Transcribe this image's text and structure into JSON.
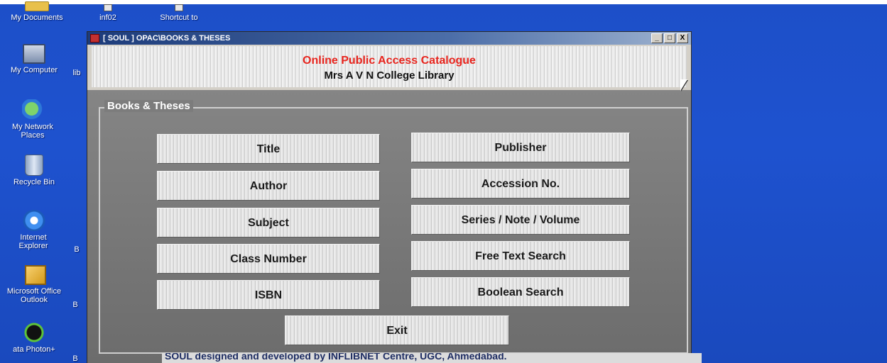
{
  "desktop": {
    "icons": [
      {
        "label": "My Documents",
        "icon": "folder-icon"
      },
      {
        "label": "inf02",
        "icon": "shortcut-icon"
      },
      {
        "label": "Shortcut to",
        "icon": "shortcut-icon"
      },
      {
        "label": "My Computer",
        "icon": "computer-icon"
      },
      {
        "label": "lib",
        "icon": "folder-icon"
      },
      {
        "label": "My Network Places",
        "icon": "network-icon"
      },
      {
        "label": "Recycle Bin",
        "icon": "recycle-bin-icon"
      },
      {
        "label": "Internet Explorer",
        "icon": "internet-explorer-icon"
      },
      {
        "label": "B",
        "icon": ""
      },
      {
        "label": "Microsoft Office Outlook",
        "icon": "outlook-icon"
      },
      {
        "label": "B",
        "icon": ""
      },
      {
        "label": "ata Photon+",
        "icon": "photon-icon"
      },
      {
        "label": "B",
        "icon": ""
      }
    ]
  },
  "window": {
    "title": "[ SOUL ] OPAC\\BOOKS & THESES",
    "controls": [
      "_",
      "□",
      "X"
    ]
  },
  "header": {
    "title": "Online Public Access Catalogue",
    "subtitle": "Mrs A V N College Library"
  },
  "panel": {
    "group_label": "Books & Theses",
    "buttons": {
      "title": "Title",
      "author": "Author",
      "subject": "Subject",
      "class_number": "Class Number",
      "isbn": "ISBN",
      "publisher": "Publisher",
      "accession": "Accession No.",
      "series": "Series / Note / Volume",
      "free_text": "Free Text Search",
      "boolean": "Boolean Search",
      "exit": "Exit"
    }
  },
  "footer": {
    "text": "SOUL designed and developed by INFLIBNET Centre, UGC, Ahmedabad."
  },
  "colors": {
    "desktop": "#1e52cf",
    "header_title": "#e8251e",
    "panel": "#7a7a7a"
  }
}
